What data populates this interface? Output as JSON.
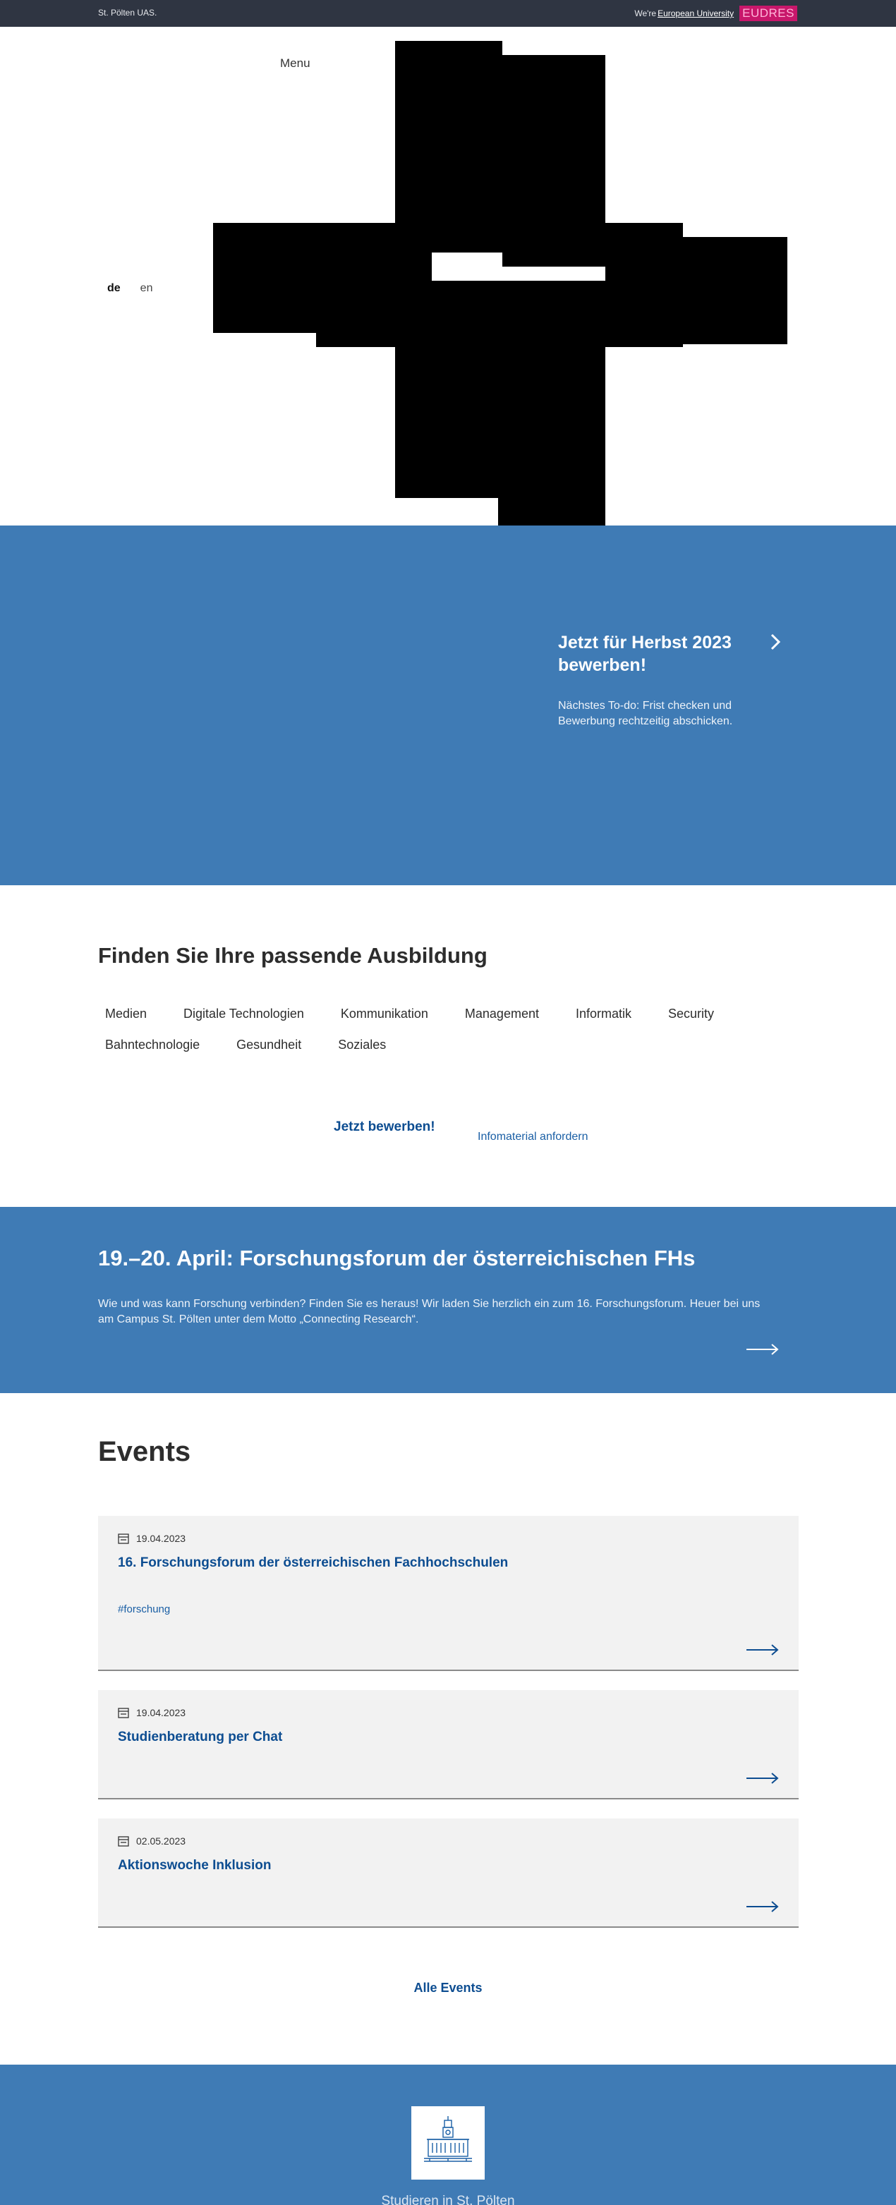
{
  "topbar": {
    "brand": "St. Pölten UAS.",
    "we_are": "We're",
    "european_university": "European University",
    "eudres": "EUDRES"
  },
  "header": {
    "menu": "Menu",
    "lang_de": "de",
    "lang_en": "en"
  },
  "hero": {
    "cta_title": "Jetzt für Herbst 2023 bewerben!",
    "cta_sub": "Nächstes To-do: Frist checken und Bewerbung rechtzeitig abschicken."
  },
  "find": {
    "title": "Finden Sie Ihre passende Ausbildung",
    "categories": [
      "Medien",
      "Digitale Technologien",
      "Kommunikation",
      "Management",
      "Informatik",
      "Security",
      "Bahntechnologie",
      "Gesundheit",
      "Soziales"
    ],
    "apply": "Jetzt bewerben!",
    "info": "Infomaterial anfordern"
  },
  "forum": {
    "title": "19.–20. April: Forschungsforum der österreichischen FHs",
    "text": "Wie und was kann Forschung verbinden? Finden Sie es heraus! Wir laden Sie herzlich ein zum 16. Forschungsforum. Heuer bei uns am Campus St. Pölten unter dem Motto „Connecting Research“."
  },
  "events": {
    "title": "Events",
    "items": [
      {
        "date": "19.04.2023",
        "title": "16. Forschungsforum der österreichischen Fachhochschulen",
        "tag": "#forschung"
      },
      {
        "date": "19.04.2023",
        "title": "Studienberatung per Chat",
        "tag": ""
      },
      {
        "date": "02.05.2023",
        "title": "Aktionswoche Inklusion",
        "tag": ""
      }
    ],
    "all": "Alle Events"
  },
  "footer": {
    "caption": "Studieren in St. Pölten"
  },
  "colors": {
    "brand_blue": "#3f7bb5",
    "link_blue": "#0d4d91",
    "topbar": "#2f3542",
    "eudres_pink": "#c8176b"
  }
}
